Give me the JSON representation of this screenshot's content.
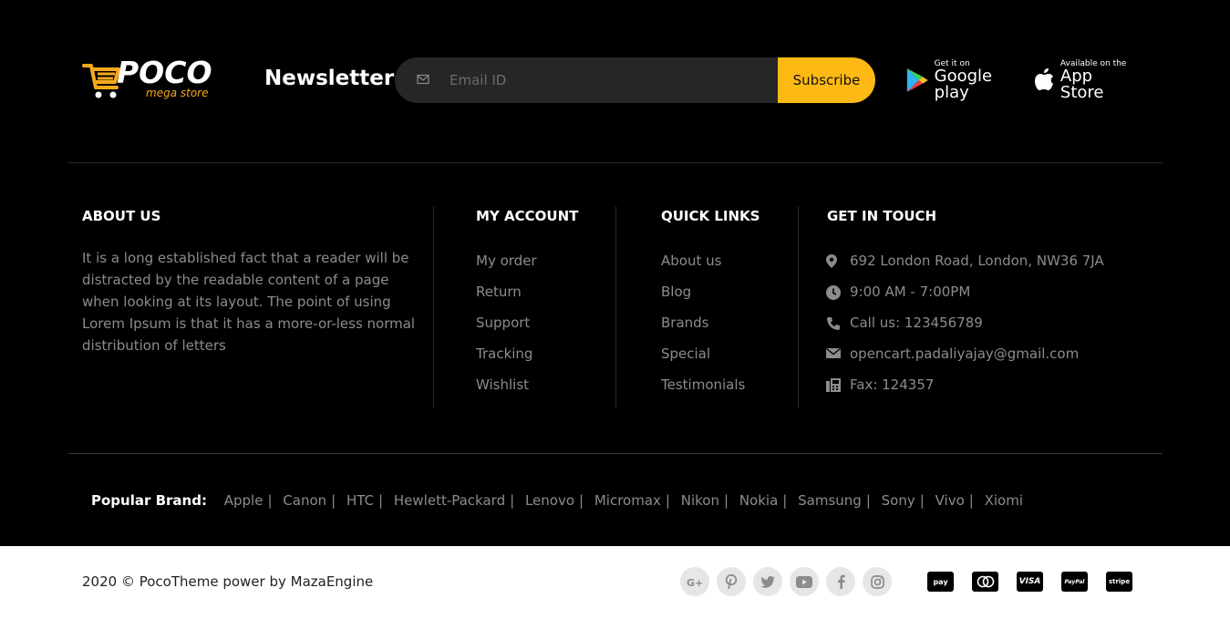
{
  "logo": {
    "name": "POCO",
    "tagline": "mega store"
  },
  "newsletter": {
    "title": "Newsletter",
    "placeholder": "Email ID",
    "button": "Subscribe"
  },
  "apps": {
    "google_play": {
      "small": "Get it on",
      "big": "Google play"
    },
    "app_store": {
      "small": "Available on the",
      "big": "App Store"
    }
  },
  "about": {
    "title": "ABOUT US",
    "text": "It is a long established fact that a reader will be distracted by the readable content of a page when looking at its layout. The point of using Lorem Ipsum is that it has a more-or-less normal distribution of letters"
  },
  "account": {
    "title": "MY ACCOUNT",
    "links": [
      "My order",
      "Return",
      "Support",
      "Tracking",
      "Wishlist"
    ]
  },
  "quick": {
    "title": "QUICK LINKS",
    "links": [
      "About us",
      "Blog",
      "Brands",
      "Special",
      "Testimonials"
    ]
  },
  "contact": {
    "title": "GET IN TOUCH",
    "items": [
      {
        "icon": "map-marker-icon",
        "text": "692 London Road, London, NW36 7JA"
      },
      {
        "icon": "clock-icon",
        "text": "9:00 AM - 7:00PM"
      },
      {
        "icon": "phone-icon",
        "text": "Call us: 123456789"
      },
      {
        "icon": "envelope-icon",
        "text": "opencart.padaliyajay@gmail.com"
      },
      {
        "icon": "fax-icon",
        "text": "Fax: 124357"
      }
    ]
  },
  "brands": {
    "label": "Popular Brand:",
    "items": [
      "Apple",
      "Canon",
      "HTC",
      "Hewlett-Packard",
      "Lenovo",
      "Micromax",
      "Nikon",
      "Nokia",
      "Samsung",
      "Sony",
      "Vivo",
      "Xiomi"
    ]
  },
  "bottom": {
    "copyright": "2020 © PocoTheme power by MazaEngine",
    "socials": [
      "google-plus-icon",
      "pinterest-icon",
      "twitter-icon",
      "youtube-icon",
      "facebook-icon",
      "instagram-icon"
    ],
    "payments": [
      {
        "icon": "amazon-pay-icon",
        "label": "pay"
      },
      {
        "icon": "mastercard-icon",
        "label": ""
      },
      {
        "icon": "visa-icon",
        "label": "VISA"
      },
      {
        "icon": "paypal-icon",
        "label": "PayPal"
      },
      {
        "icon": "stripe-icon",
        "label": "stripe"
      }
    ]
  },
  "colors": {
    "accent": "#fdb913",
    "background": "#000000",
    "muted_text": "#8c8c8c"
  }
}
